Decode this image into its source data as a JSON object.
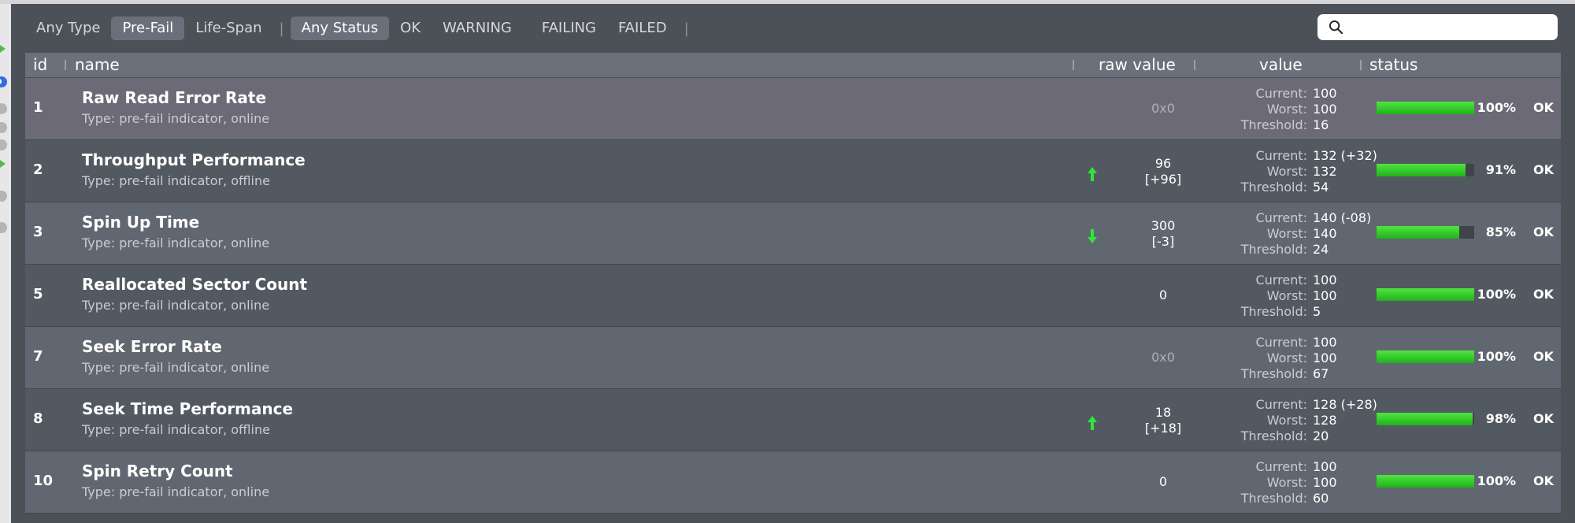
{
  "filters": {
    "type": [
      "Any Type",
      "Pre-Fail",
      "Life-Span"
    ],
    "active_type": 1,
    "status": [
      "Any Status",
      "OK",
      "WARNING",
      "FAILING",
      "FAILED"
    ],
    "active_status": 0,
    "separator": "|"
  },
  "search": {
    "placeholder": "",
    "value": ""
  },
  "columns": {
    "id": "id",
    "name": "name",
    "raw": "raw value",
    "value": "value",
    "status": "status"
  },
  "value_labels": {
    "current": "Current:",
    "worst": "Worst:",
    "threshold": "Threshold:"
  },
  "rows": [
    {
      "id": "1",
      "name": "Raw Read Error Rate",
      "type": "Type: pre-fail indicator, online",
      "raw": "0x0",
      "raw_dim": true,
      "trend": "",
      "current": "100",
      "worst": "100",
      "threshold": "16",
      "pct_label": "100%",
      "pct": 100,
      "status": "OK"
    },
    {
      "id": "2",
      "name": "Throughput Performance",
      "type": "Type: pre-fail indicator, offline",
      "raw": "96",
      "raw_delta": "[+96]",
      "trend": "up",
      "current": "132  (+32)",
      "worst": "132",
      "threshold": "54",
      "pct_label": "91%",
      "pct": 91,
      "status": "OK"
    },
    {
      "id": "3",
      "name": "Spin Up Time",
      "type": "Type: pre-fail indicator, online",
      "raw": "300",
      "raw_delta": "[-3]",
      "trend": "down",
      "current": "140  (-08)",
      "worst": "140",
      "threshold": "24",
      "pct_label": "85%",
      "pct": 85,
      "status": "OK"
    },
    {
      "id": "5",
      "name": "Reallocated Sector Count",
      "type": "Type: pre-fail indicator, online",
      "raw": "0",
      "trend": "",
      "current": "100",
      "worst": "100",
      "threshold": "5",
      "pct_label": "100%",
      "pct": 100,
      "status": "OK"
    },
    {
      "id": "7",
      "name": "Seek Error Rate",
      "type": "Type: pre-fail indicator, online",
      "raw": "0x0",
      "raw_dim": true,
      "trend": "",
      "current": "100",
      "worst": "100",
      "threshold": "67",
      "pct_label": "100%",
      "pct": 100,
      "status": "OK"
    },
    {
      "id": "8",
      "name": "Seek Time Performance",
      "type": "Type: pre-fail indicator, offline",
      "raw": "18",
      "raw_delta": "[+18]",
      "trend": "up",
      "current": "128  (+28)",
      "worst": "128",
      "threshold": "20",
      "pct_label": "98%",
      "pct": 98,
      "status": "OK"
    },
    {
      "id": "10",
      "name": "Spin Retry Count",
      "type": "Type: pre-fail indicator, online",
      "raw": "0",
      "trend": "",
      "current": "100",
      "worst": "100",
      "threshold": "60",
      "pct_label": "100%",
      "pct": 100,
      "status": "OK"
    }
  ],
  "colors": {
    "trend_color": "#2fe53a",
    "bar_fill": "#2cc82a",
    "active_pill": "#69707a"
  }
}
